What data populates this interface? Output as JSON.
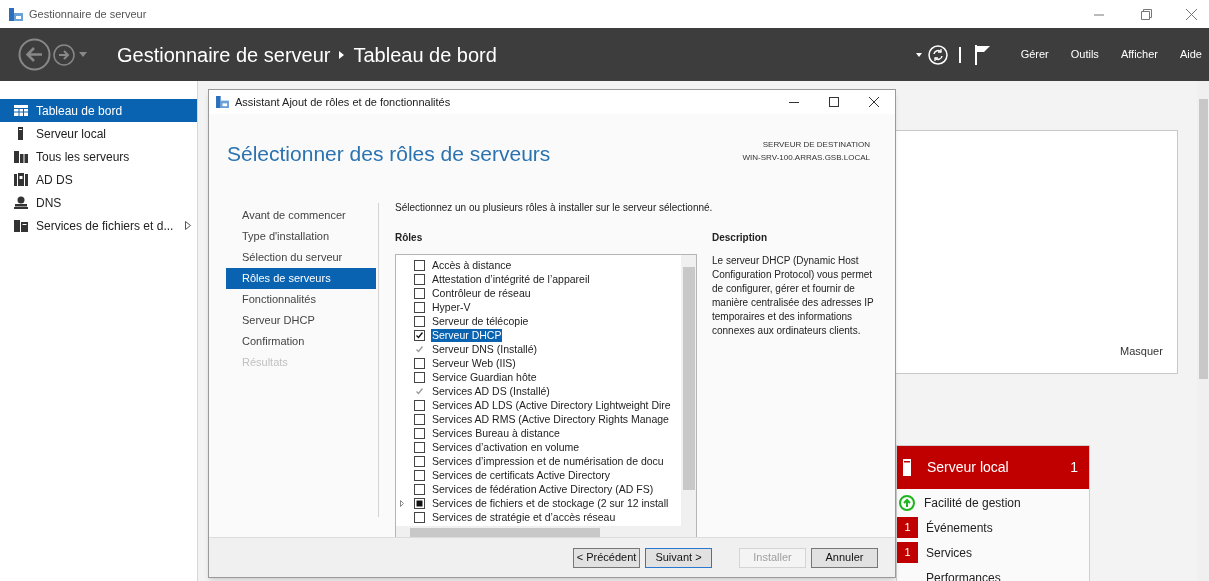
{
  "window": {
    "title": "Gestionnaire de serveur"
  },
  "header": {
    "breadcrumb": [
      "Gestionnaire de serveur",
      "Tableau de bord"
    ],
    "menu": [
      "Gérer",
      "Outils",
      "Afficher",
      "Aide"
    ]
  },
  "sidebar": {
    "items": [
      {
        "label": "Tableau de bord",
        "selected": true
      },
      {
        "label": "Serveur local",
        "selected": false
      },
      {
        "label": "Tous les serveurs",
        "selected": false
      },
      {
        "label": "AD DS",
        "selected": false
      },
      {
        "label": "DNS",
        "selected": false
      },
      {
        "label": "Services de fichiers et d...",
        "selected": false,
        "expandable": true
      }
    ]
  },
  "welcome_panel": {
    "hide_link": "Masquer"
  },
  "tile": {
    "title": "Serveur local",
    "count": "1",
    "rows": [
      {
        "kind": "status",
        "label": "Facilité de gestion"
      },
      {
        "kind": "badge",
        "badge": "1",
        "label": "Événements"
      },
      {
        "kind": "badge",
        "badge": "1",
        "label": "Services"
      },
      {
        "kind": "plain",
        "label": "Performances"
      }
    ]
  },
  "dialog": {
    "title": "Assistant Ajout de rôles et de fonctionnalités",
    "heading": "Sélectionner des rôles de serveurs",
    "destination_label": "SERVEUR DE DESTINATION",
    "destination": "WIN-SRV-100.ARRAS.GSB.LOCAL",
    "steps": [
      {
        "label": "Avant de commencer",
        "selected": false,
        "disabled": false
      },
      {
        "label": "Type d'installation",
        "selected": false,
        "disabled": false
      },
      {
        "label": "Sélection du serveur",
        "selected": false,
        "disabled": false
      },
      {
        "label": "Rôles de serveurs",
        "selected": true,
        "disabled": false
      },
      {
        "label": "Fonctionnalités",
        "selected": false,
        "disabled": false
      },
      {
        "label": "Serveur DHCP",
        "selected": false,
        "disabled": false
      },
      {
        "label": "Confirmation",
        "selected": false,
        "disabled": false
      },
      {
        "label": "Résultats",
        "selected": false,
        "disabled": true
      }
    ],
    "instruction": "Sélectionnez un ou plusieurs rôles à installer sur le serveur sélectionné.",
    "roles_label": "Rôles",
    "roles": [
      {
        "label": "Accès à distance",
        "checked": false,
        "disabled": false,
        "partial": false,
        "selected": false
      },
      {
        "label": "Attestation d’intégrité de l’appareil",
        "checked": false,
        "disabled": false,
        "partial": false,
        "selected": false
      },
      {
        "label": "Contrôleur de réseau",
        "checked": false,
        "disabled": false,
        "partial": false,
        "selected": false
      },
      {
        "label": "Hyper-V",
        "checked": false,
        "disabled": false,
        "partial": false,
        "selected": false
      },
      {
        "label": "Serveur de télécopie",
        "checked": false,
        "disabled": false,
        "partial": false,
        "selected": false
      },
      {
        "label": "Serveur DHCP",
        "checked": true,
        "disabled": false,
        "partial": false,
        "selected": true
      },
      {
        "label": "Serveur DNS (Installé)",
        "checked": true,
        "disabled": true,
        "partial": false,
        "selected": false
      },
      {
        "label": "Serveur Web (IIS)",
        "checked": false,
        "disabled": false,
        "partial": false,
        "selected": false
      },
      {
        "label": "Service Guardian hôte",
        "checked": false,
        "disabled": false,
        "partial": false,
        "selected": false
      },
      {
        "label": "Services AD DS (Installé)",
        "checked": true,
        "disabled": true,
        "partial": false,
        "selected": false
      },
      {
        "label": "Services AD LDS (Active Directory Lightweight Dire",
        "checked": false,
        "disabled": false,
        "partial": false,
        "selected": false
      },
      {
        "label": "Services AD RMS (Active Directory Rights Manage",
        "checked": false,
        "disabled": false,
        "partial": false,
        "selected": false
      },
      {
        "label": "Services Bureau à distance",
        "checked": false,
        "disabled": false,
        "partial": false,
        "selected": false
      },
      {
        "label": "Services d’activation en volume",
        "checked": false,
        "disabled": false,
        "partial": false,
        "selected": false
      },
      {
        "label": "Services d’impression et de numérisation de docu",
        "checked": false,
        "disabled": false,
        "partial": false,
        "selected": false
      },
      {
        "label": "Services de certificats Active Directory",
        "checked": false,
        "disabled": false,
        "partial": false,
        "selected": false
      },
      {
        "label": "Services de fédération Active Directory (AD FS)",
        "checked": false,
        "disabled": false,
        "partial": false,
        "selected": false
      },
      {
        "label": "Services de fichiers et de stockage (2 sur 12 install",
        "checked": false,
        "disabled": false,
        "partial": true,
        "selected": false,
        "expandable": true
      },
      {
        "label": "Services de stratégie et d’accès réseau",
        "checked": false,
        "disabled": false,
        "partial": false,
        "selected": false
      }
    ],
    "description_label": "Description",
    "description": "Le serveur DHCP (Dynamic Host Configuration Protocol) vous permet de configurer, gérer et fournir de manière centralisée des adresses IP temporaires et des informations connexes aux ordinateurs clients.",
    "buttons": [
      {
        "label": "< Précédent",
        "kind": "normal",
        "disabled": false
      },
      {
        "label": "Suivant >",
        "kind": "default",
        "disabled": false
      },
      {
        "label": "Installer",
        "kind": "normal",
        "disabled": true
      },
      {
        "label": "Annuler",
        "kind": "normal",
        "disabled": false
      }
    ]
  }
}
